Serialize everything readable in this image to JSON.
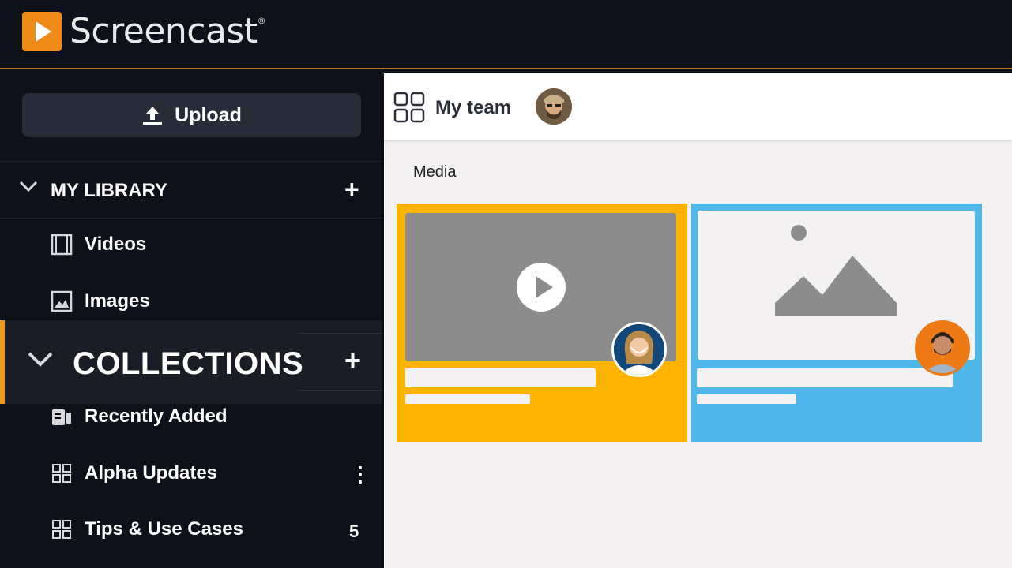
{
  "app": {
    "logo_text": "Screencast",
    "trademark": "®"
  },
  "sidebar": {
    "upload_label": "Upload",
    "library": {
      "title": "MY LIBRARY",
      "items": [
        {
          "label": "Videos",
          "icon": "film-icon"
        },
        {
          "label": "Images",
          "icon": "image-icon"
        }
      ]
    },
    "collections": {
      "title": "COLLECTIONS",
      "items": [
        {
          "label": "Recently Added",
          "icon": "recent-icon"
        },
        {
          "label": "Alpha Updates",
          "icon": "grid-icon",
          "trailing": "⋮"
        },
        {
          "label": "Tips & Use Cases",
          "icon": "grid-icon",
          "trailing": "5"
        }
      ]
    }
  },
  "main": {
    "title": "My team",
    "section_label": "Media"
  },
  "colors": {
    "accent": "#f19a1f",
    "video_card": "#fdb302",
    "image_card": "#4fb7ea"
  }
}
